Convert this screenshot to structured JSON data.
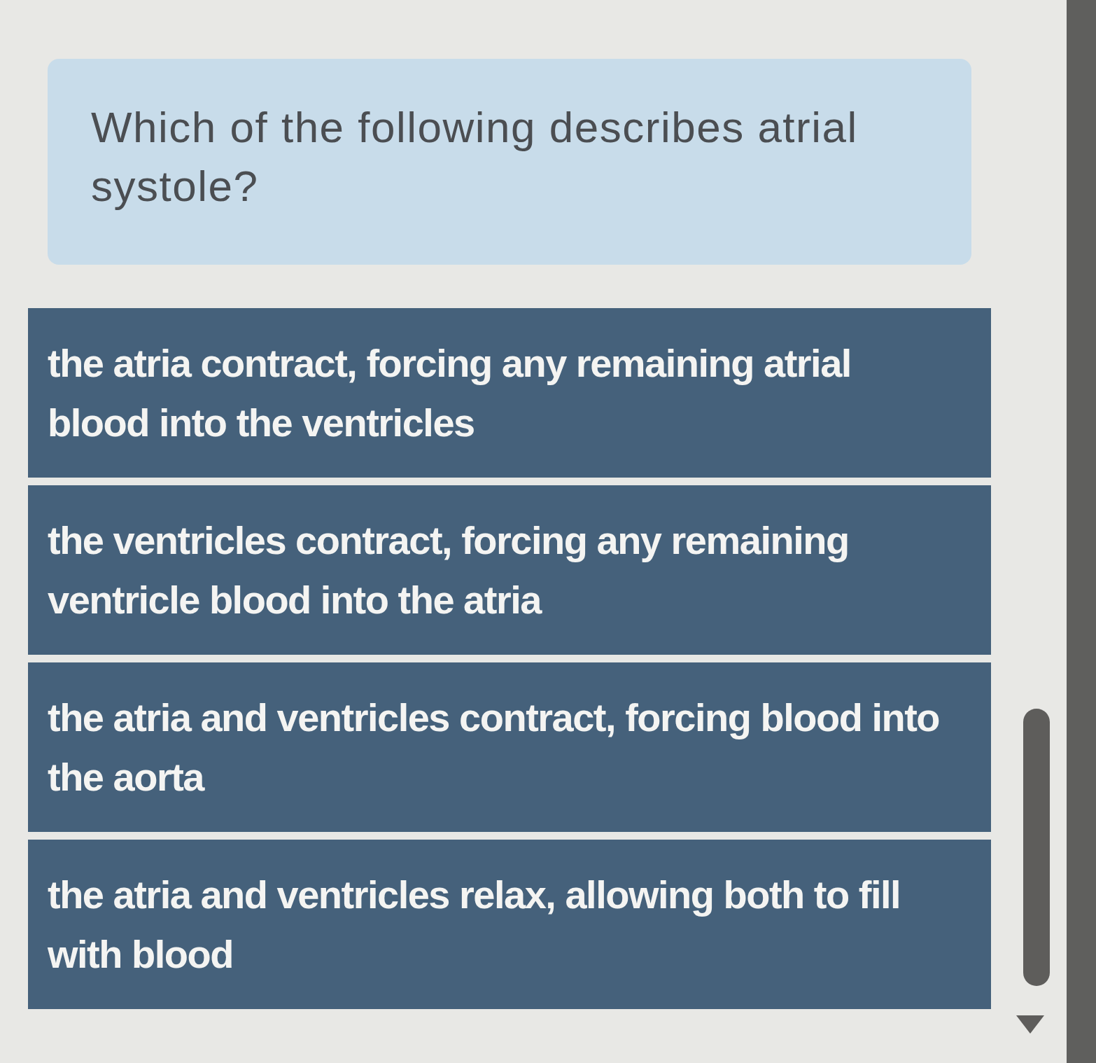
{
  "question": {
    "text": "Which of the following describes atrial systole?"
  },
  "options": [
    {
      "text": "the atria contract, forcing any remaining atrial blood into the ventricles",
      "selected": false
    },
    {
      "text": "the ventricles contract, forcing any remaining ventricle blood into the atria",
      "selected": false
    },
    {
      "text": "the atria and ventricles contract, forcing blood into the aorta",
      "selected": false
    },
    {
      "text": "the atria and ventricles relax, allowing both to fill with blood",
      "selected": false
    }
  ]
}
